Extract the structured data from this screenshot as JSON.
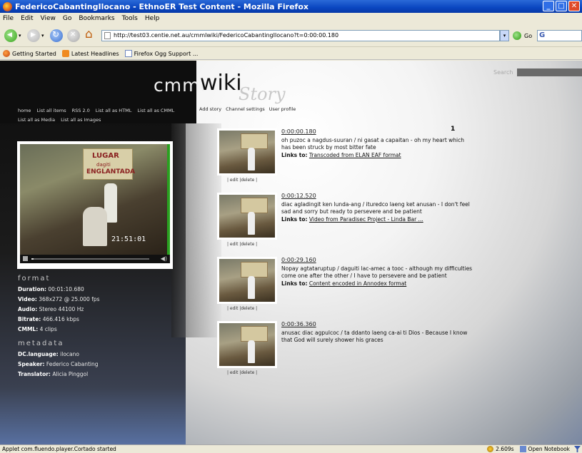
{
  "window": {
    "title": "FedericoCabantingIlocano - EthnoER Test Content - Mozilla Firefox",
    "buttons": [
      "_",
      "□",
      "✕"
    ]
  },
  "menu": [
    "File",
    "Edit",
    "View",
    "Go",
    "Bookmarks",
    "Tools",
    "Help"
  ],
  "navbar": {
    "url": "http://test03.centie.net.au/cmmlwiki/FedericoCabantingIlocano?t=0:00:00.180",
    "go_label": "Go"
  },
  "bookmarks": [
    "Getting Started",
    "Latest Headlines",
    "Firefox Ogg Support ..."
  ],
  "site": {
    "logo_cmml": "cmml",
    "logo_wiki": "wiki",
    "logo_story": "Story",
    "search_label": "Search",
    "nav_dark": [
      "home",
      "List all items",
      "RSS 2.0",
      "List all as HTML",
      "List all as CMML",
      "List all as Media",
      "List all as Images"
    ],
    "nav_light": [
      "Add story",
      "Channel settings",
      "User profile"
    ]
  },
  "player": {
    "banner_line1": "LUGAR",
    "banner_line2": "dagiti",
    "banner_line3": "ENGLANTADA",
    "timestamp": "21:51:01",
    "progress": 0.02
  },
  "format": {
    "heading": "format",
    "duration_label": "Duration:",
    "duration": "00:01:10.680",
    "video_label": "Video:",
    "video": "368x272 @ 25.000 fps",
    "audio_label": "Audio:",
    "audio": "Stereo 44100 Hz",
    "bitrate_label": "Bitrate:",
    "bitrate": "466.416 kbps",
    "cmml_label": "CMML:",
    "cmml": "4 clips"
  },
  "metadata": {
    "heading": "metadata",
    "lang_label": "DC.language:",
    "lang": "ilocano",
    "speaker_label": "Speaker:",
    "speaker": "Federico Cabanting",
    "translator_label": "Translator:",
    "translator": "Alicia Pinggol"
  },
  "page_number": "1",
  "clips": [
    {
      "time": "0:00:00.180",
      "desc": "oh puzoc a nagdus-suuran / ni gasat a capaitan - oh my heart which has been struck by most bitter fate",
      "links_label": "Links to:",
      "link": "Transcoded from ELAN EAF format",
      "edit": "| edit |delete |"
    },
    {
      "time": "0:00:12.520",
      "desc": "diac agladingit ken lunda-ang / ituredco laeng ket anusan - I don't feel sad and sorry but ready to persevere and be patient",
      "links_label": "Links to:",
      "link": "Video from Paradisec Project - Linda Bar ...",
      "edit": "| edit |delete |"
    },
    {
      "time": "0:00:29.160",
      "desc": "Nopay agtataruptup / daguiti lac-amec a tooc - although my difficulties come one after the other / I have to persevere and be patient",
      "links_label": "Links to:",
      "link": "Content encoded in Annodex format",
      "edit": "| edit |delete |"
    },
    {
      "time": "0:00:36.360",
      "desc": "anusac diac agpulcoc / ta ddanto laeng ca-ai ti Dios - Because I know that God will surely shower his graces",
      "links_label": "",
      "link": "",
      "edit": "| edit |delete |"
    }
  ],
  "status": {
    "text": "Applet com.fluendo.player.Cortado started",
    "timing": "2.609s",
    "notebook": "Open Notebook"
  }
}
